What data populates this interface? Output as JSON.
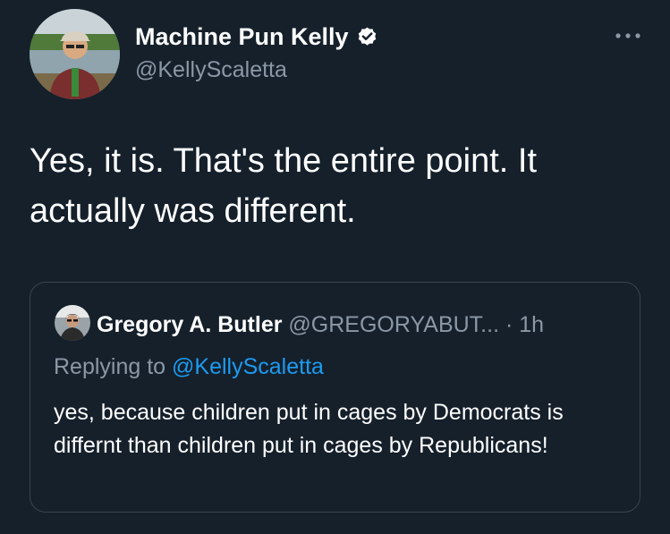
{
  "tweet": {
    "author_name": "Machine Pun Kelly",
    "author_handle": "@KellyScaletta",
    "avatar_icon": "user-avatar-photo",
    "verified_icon": "verified-badge-icon",
    "more_icon": "more-options-icon",
    "text": "Yes, it is. That's the entire point. It actually was different."
  },
  "quoted_tweet": {
    "author_name": "Gregory A. Butler",
    "author_handle": "@GREGORYABUT...",
    "separator": "·",
    "timestamp": "1h",
    "avatar_icon": "user-avatar-photo",
    "replying_prefix": "Replying to",
    "replying_to": "@KellyScaletta",
    "text": "yes, because children put in cages by Democrats is differnt than  children put in cages by Republicans!"
  },
  "colors": {
    "background": "#15202b",
    "primary_text": "#ffffff",
    "secondary_text": "#8b98a5",
    "link": "#1d9bf0",
    "border": "#38444d"
  }
}
